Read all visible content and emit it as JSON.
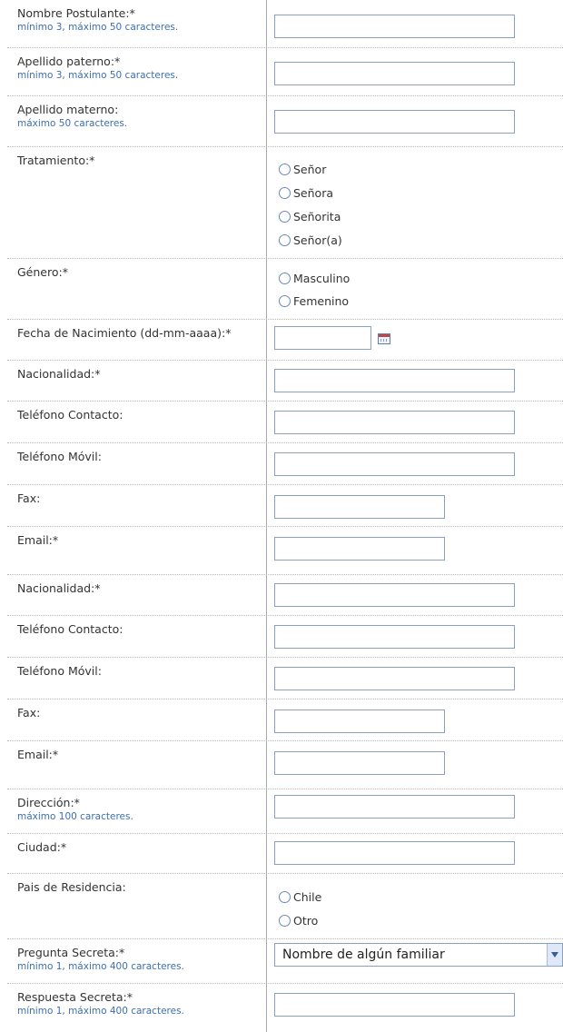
{
  "form": {
    "fields": [
      {
        "label": "Nombre Postulante:*",
        "hint": "mínimo 3, máximo 50 caracteres."
      },
      {
        "label": "Apellido paterno:*",
        "hint": "mínimo 3, máximo 50 caracteres."
      },
      {
        "label": "Apellido materno:",
        "hint": "máximo 50 caracteres."
      },
      {
        "label": "Tratamiento:*",
        "options": [
          "Señor",
          "Señora",
          "Señorita",
          "Señor(a)"
        ]
      },
      {
        "label": "Género:*",
        "options": [
          "Masculino",
          "Femenino"
        ]
      },
      {
        "label": "Fecha de Nacimiento (dd-mm-aaaa):*",
        "value": ""
      },
      {
        "label": "Nacionalidad:*",
        "value": ""
      },
      {
        "label": "Teléfono Contacto:",
        "value": ""
      },
      {
        "label": "Teléfono Móvil:",
        "value": ""
      },
      {
        "label": "Fax:",
        "value": ""
      },
      {
        "label": "Email:*",
        "value": ""
      },
      {
        "label": "Nacionalidad:*",
        "value": ""
      },
      {
        "label": "Teléfono Contacto:",
        "value": ""
      },
      {
        "label": "Teléfono Móvil:",
        "value": ""
      },
      {
        "label": "Fax:",
        "value": ""
      },
      {
        "label": "Email:*",
        "value": ""
      },
      {
        "label": "Dirección:*",
        "hint": "máximo 100 caracteres."
      },
      {
        "label": "Ciudad:*",
        "value": ""
      },
      {
        "label": "Pais de Residencia:",
        "options": [
          "Chile",
          "Otro"
        ]
      },
      {
        "label": "Pregunta Secreta:*",
        "hint": "mínimo 1, máximo 400 caracteres.",
        "selected": "Nombre de algún familiar"
      },
      {
        "label": "Respuesta Secreta:*",
        "hint": "mínimo 1, máximo 400 caracteres."
      }
    ]
  },
  "icons": {
    "calendar": "calendar-icon",
    "select_arrow": "chevron-down-icon"
  },
  "colors": {
    "hint_text": "#3d6fb0",
    "border": "#8aa0c2",
    "divider": "#a8a8a8"
  }
}
